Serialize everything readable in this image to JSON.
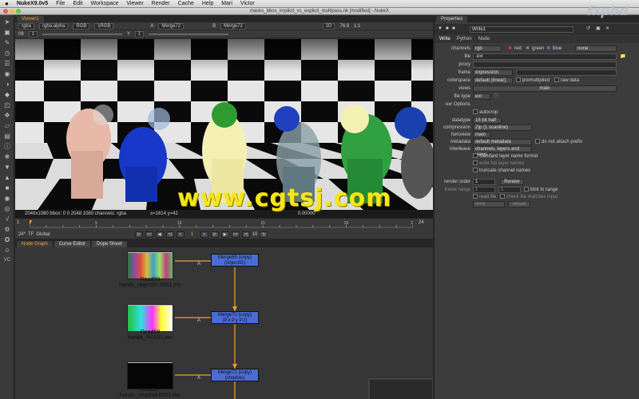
{
  "menubar": {
    "app": "NukeX9.0v5",
    "items": [
      "File",
      "Edit",
      "Workspace",
      "Viewer",
      "Render",
      "Cache",
      "Help",
      "Mari",
      "Victor"
    ]
  },
  "window": {
    "title": "masks_bbox_implicit_vs_explicit_multipass.nk [modified] - NukeX"
  },
  "viewer": {
    "tab": "Viewer1",
    "channels": "rgba",
    "channel2": "rgba.alpha",
    "colorspace": "RGB",
    "lut": "sRGB",
    "a_input": "Merge72",
    "b_input": "Merge72",
    "view_mode": "2D",
    "f_stop": "f/8",
    "f_value": "1",
    "y_label": "Y",
    "y_value": "1",
    "zoom": "76.9",
    "ratio": "1:1",
    "status_left": "2048x1080  bbox: 0 0 2048 1080 channels: rgba",
    "status_mid": "x=1614 y=42",
    "status_right": "0.00000"
  },
  "timeline": {
    "start": "1",
    "end": "24",
    "current": "1",
    "ticks": [
      "1",
      "5",
      "10",
      "15",
      "20",
      "24"
    ],
    "fps": "24*",
    "tf": "TF",
    "global": "Global",
    "inc": "10"
  },
  "nodegraph": {
    "tabs": [
      "Node Graph",
      "Curve Editor",
      "Dope Sheet"
    ],
    "reads": [
      {
        "name": "Read59",
        "file": "hands_objectID.0001.exr"
      },
      {
        "name": "Read58",
        "file": "hands_P.0001.exr"
      },
      {
        "name": "Read57",
        "file": "hands_shadow.0001.exr"
      }
    ],
    "merges": [
      {
        "name": "Merge69 (copy)",
        "sub": "(objectID)"
      },
      {
        "name": "Merge70 (copy)",
        "sub": "(P.x P.y P.z)"
      },
      {
        "name": "Merge71 (copy)",
        "sub": "(shadow)"
      }
    ],
    "pipe_label": "A"
  },
  "props": {
    "title": "Properties",
    "node_name": "Write1",
    "tabs": [
      "Write",
      "Python",
      "Node"
    ],
    "channels_label": "channels",
    "channels_value": "rgb",
    "ch_red": "red",
    "ch_green": "green",
    "ch_blue": "blue",
    "ch_none": "none",
    "file_label": "file",
    "file_value": ".exr",
    "proxy_label": "proxy",
    "frame_label": "frame",
    "frame_value": "expression",
    "colorspace_label": "colorspace",
    "colorspace_value": "default (linear)",
    "premultiplied": "premultiplied",
    "raw_data": "raw data",
    "views_label": "views",
    "views_value": "main",
    "filetype_label": "file type",
    "filetype_value": "exr",
    "exr_options": "exr Options",
    "autocrop": "autocrop",
    "datatype_label": "datatype",
    "datatype_value": "16 bit half",
    "compression_label": "compression",
    "compression_value": "Zip (1 scanline)",
    "heroview_label": "heroview",
    "heroview_value": "main",
    "metadata_label": "metadata",
    "metadata_value": "default metadata",
    "no_prefix": "do not attach prefix",
    "interleave_label": "interleave",
    "interleave_value": "channels, layers and views",
    "std_layer": "standard layer name format",
    "write_full": "write full layer names",
    "truncate": "truncate channel names",
    "render_order_label": "render order",
    "render_order_value": "1",
    "render_button": "Render",
    "frame_range_label": "frame range",
    "fr_start": "1",
    "fr_end": "1",
    "limit_range": "limit to range",
    "read_file": "read file",
    "check_file": "check file matches input",
    "on_error_value": "error",
    "reload": "reload"
  },
  "watermark": "www.cgtsj.com",
  "brand": "fxphd"
}
